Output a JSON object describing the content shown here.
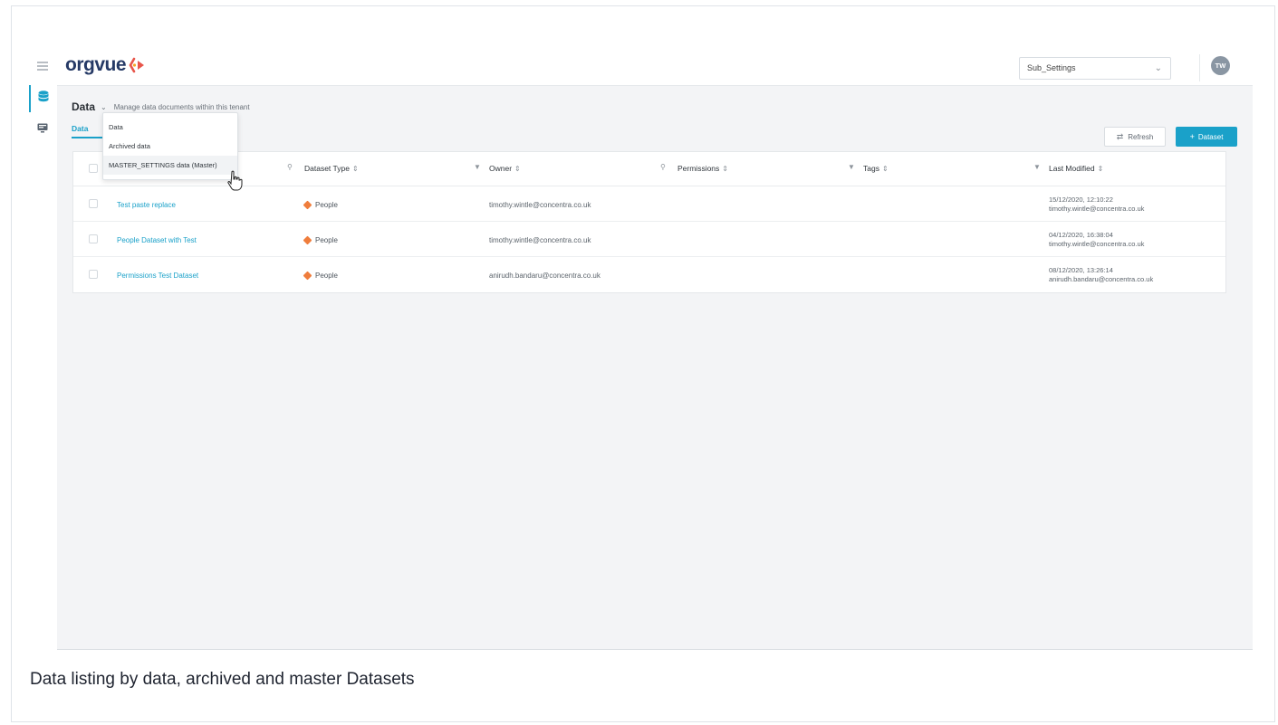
{
  "app": {
    "logo_text": "orgvue",
    "tenant_select_value": "Sub_Settings",
    "avatar_initials": "TW"
  },
  "rail": {
    "items": [
      {
        "icon": "database-icon",
        "active": true
      },
      {
        "icon": "monitor-icon",
        "active": false
      }
    ]
  },
  "header": {
    "title": "Data",
    "subtitle": "Manage data documents within this tenant"
  },
  "tab": {
    "label": "Data"
  },
  "dropdown": {
    "items": [
      "Data",
      "Archived data",
      "MASTER_SETTINGS data (Master)"
    ]
  },
  "toolbar": {
    "refresh_label": "Refresh",
    "dataset_label": "Dataset"
  },
  "table": {
    "headers": {
      "dataset_type": "Dataset Type",
      "owner": "Owner",
      "permissions": "Permissions",
      "tags": "Tags",
      "last_modified": "Last Modified"
    },
    "rows": [
      {
        "name": "Test paste replace",
        "type": "People",
        "owner": "timothy.wintle@concentra.co.uk",
        "modified_date": "15/12/2020, 12:10:22",
        "modified_by": "timothy.wintle@concentra.co.uk"
      },
      {
        "name": "People Dataset with Test",
        "type": "People",
        "owner": "timothy.wintle@concentra.co.uk",
        "modified_date": "04/12/2020, 16:38:04",
        "modified_by": "timothy.wintle@concentra.co.uk"
      },
      {
        "name": "Permissions Test Dataset",
        "type": "People",
        "owner": "anirudh.bandaru@concentra.co.uk",
        "modified_date": "08/12/2020, 13:26:14",
        "modified_by": "anirudh.bandaru@concentra.co.uk"
      }
    ]
  },
  "caption": "Data listing by data, archived and master Datasets",
  "colors": {
    "accent": "#1aa1c9",
    "brand_navy": "#263a66",
    "people_dot": "#ef7d3c"
  }
}
